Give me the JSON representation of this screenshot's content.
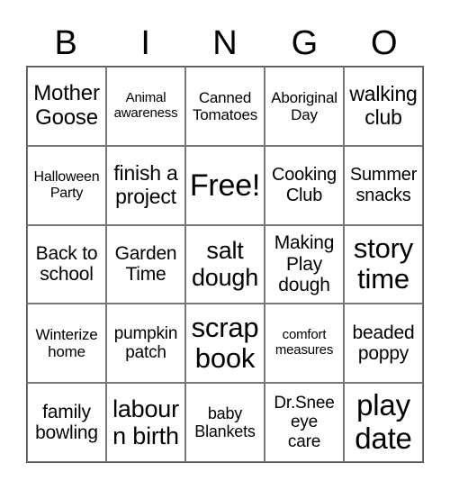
{
  "header": [
    "B",
    "I",
    "N",
    "G",
    "O"
  ],
  "cells": [
    "Mother\nGoose",
    "Animal\nawareness",
    "Canned\nTomatoes",
    "Aboriginal\nDay",
    "walking\nclub",
    "Halloween\nParty",
    "finish a\nproject",
    "Free!",
    "Cooking\nClub",
    "Summer\nsnacks",
    "Back to\nschool",
    "Garden\nTime",
    "salt\ndough",
    "Making\nPlay\ndough",
    "story\ntime",
    "Winterize\nhome",
    "pumpkin\npatch",
    "scrap\nbook",
    "comfort\nmeasures",
    "beaded\npoppy",
    "family\nbowling",
    "labour\nn birth",
    "baby\nBlankets",
    "Dr.Snee\neye\ncare",
    "play\ndate"
  ]
}
